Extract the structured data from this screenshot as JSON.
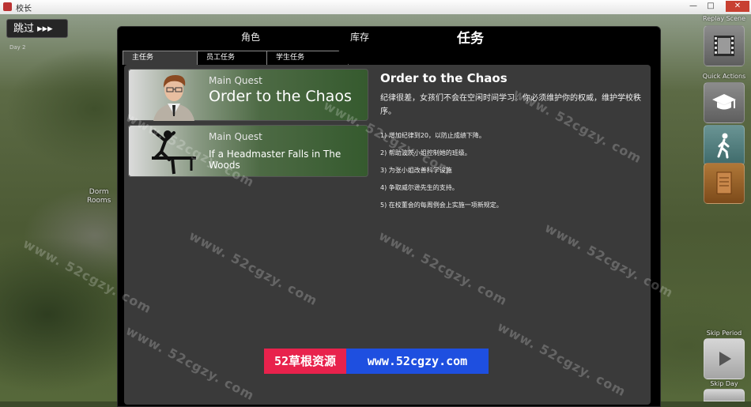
{
  "window": {
    "title": "校长",
    "minimize_glyph": "—",
    "maximize_glyph": "□",
    "close_glyph": "✕"
  },
  "hud": {
    "skip_label": "跳过 ▸▸▸",
    "day_label": "Day 2",
    "dorm_label_line1": "Dorm",
    "dorm_label_line2": "Rooms",
    "replay_scene": "Replay Scene",
    "quick_actions": "Quick Actions",
    "skip_period": "Skip Period",
    "skip_day": "Skip Day"
  },
  "tabs": {
    "character": "角色",
    "inventory": "库存",
    "tasks": "任务"
  },
  "sub_tabs": {
    "main": "主任务",
    "staff": "员工任务",
    "student": "学生任务"
  },
  "quests": [
    {
      "type": "Main Quest",
      "title": "Order to the Chaos",
      "icon": "portrait"
    },
    {
      "type": "Main Quest",
      "title": "If a Headmaster Falls in The Woods",
      "icon": "falling-person-icon"
    }
  ],
  "detail": {
    "title": "Order to the Chaos",
    "description": "纪律很差，女孩们不会在空闲时间学习。你必须维护你的权威，维护学校秩序。",
    "objectives": [
      "1) 增加纪律到20，以防止成绩下降。",
      "2) 帮助波茨小姐控制她的班级。",
      "3) 为张小姐改善科学设施",
      "4) 争取威尔逊先生的支持。",
      "5) 在校董会的每周例会上实施一项新规定。"
    ]
  },
  "watermark_text": "www. 52cgzy. com",
  "banner": {
    "left": "52草根资源",
    "right": "www.52cgzy.com"
  },
  "colors": {
    "banner_red": "#e8224c",
    "banner_blue": "#1e4fe0",
    "quest_green": "#355a2e"
  }
}
